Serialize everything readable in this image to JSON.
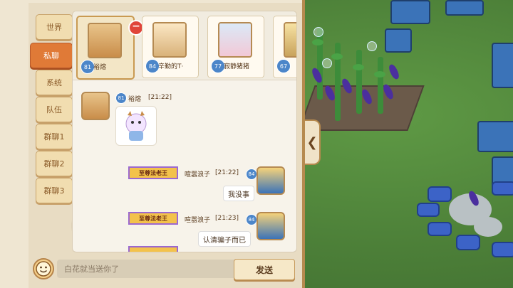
{
  "side_tabs": [
    {
      "label": "世界",
      "active": false
    },
    {
      "label": "私聊",
      "active": true
    },
    {
      "label": "系统",
      "active": false
    },
    {
      "label": "队伍",
      "active": false
    },
    {
      "label": "群聊1",
      "active": false
    },
    {
      "label": "群聊2",
      "active": false
    },
    {
      "label": "群聊3",
      "active": false
    }
  ],
  "contacts": [
    {
      "name": "裕熔",
      "level": "81",
      "selected": true
    },
    {
      "name": "辛勤的T·",
      "level": "84",
      "selected": false
    },
    {
      "name": "寂静猪猪",
      "level": "77",
      "selected": false
    },
    {
      "name": "",
      "level": "67",
      "selected": false
    }
  ],
  "remove_contact_glyph": "−",
  "messages": [
    {
      "sender": "裕熔",
      "level": "81",
      "time": "[21:22]",
      "type": "sticker"
    },
    {
      "sender": "喧嚣浪子",
      "level": "84",
      "time": "[21:22]",
      "title": "至尊法老王",
      "text": "我没事"
    },
    {
      "sender": "喧嚣浪子",
      "level": "84",
      "time": "[21:23]",
      "title": "至尊法老王",
      "text": "认清骗子而已"
    }
  ],
  "collapse_glyph": "❮",
  "input": {
    "placeholder": "白花就当送你了"
  },
  "send_label": "发送",
  "colors": {
    "active_tab": "#e07a37",
    "panel_border": "#b68a4f",
    "level_badge": "#4c86c9",
    "title_badge": "#f3c24b"
  },
  "icons": {
    "emoji": "emoji-icon",
    "collapse": "chevron-left-icon",
    "remove": "minus-icon"
  }
}
